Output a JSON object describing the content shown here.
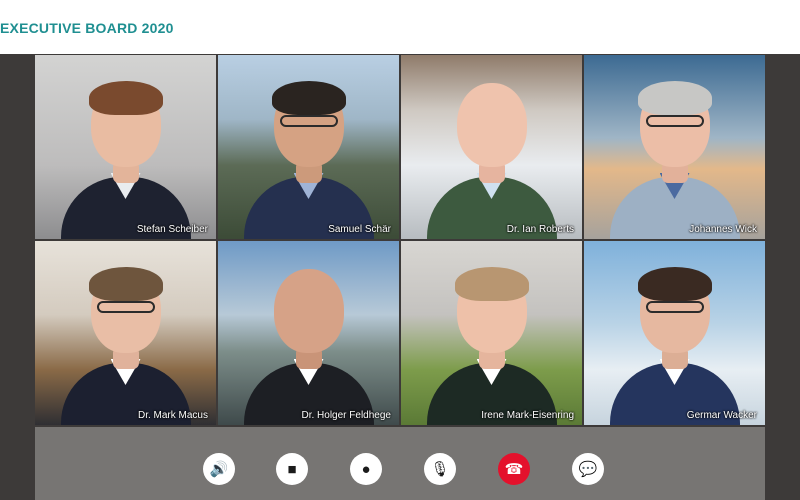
{
  "header": {
    "title": "EXECUTIVE BOARD 2020"
  },
  "participants": [
    {
      "name": "Stefan Scheiber"
    },
    {
      "name": "Samuel Schär"
    },
    {
      "name": "Dr. Ian Roberts"
    },
    {
      "name": "Johannes Wick"
    },
    {
      "name": "Dr. Mark Macus"
    },
    {
      "name": "Dr. Holger Feldhege"
    },
    {
      "name": "Irene Mark-Eisenring"
    },
    {
      "name": "Germar Wacker"
    }
  ],
  "controls": {
    "speaker_icon": "🔊",
    "camera_icon": "■",
    "participants_icon": "●",
    "mic_icon": "🎙",
    "hangup_icon": "☎",
    "chat_icon": "💬",
    "hangup_color": "#e4112c"
  }
}
